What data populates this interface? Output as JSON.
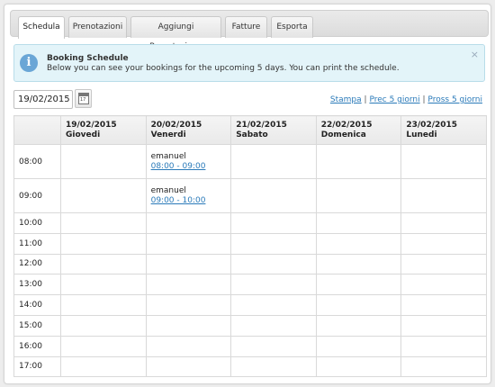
{
  "tabs": [
    "Schedula",
    "Prenotazioni",
    "Aggiungi Prenotazione",
    "Fatture",
    "Esporta"
  ],
  "alert": {
    "title": "Booking Schedule",
    "text": "Below you can see your bookings for the upcoming 5 days. You can print the schedule.",
    "close": "×",
    "icon": "info-icon"
  },
  "date_input": {
    "value": "19/02/2015"
  },
  "calendar_icon_day": "17",
  "links": {
    "print": "Stampa",
    "sep": "|",
    "prev": "Prec 5 giorni",
    "next": "Pross 5 giorni"
  },
  "days": [
    {
      "date": "19/02/2015",
      "name": "Giovedi"
    },
    {
      "date": "20/02/2015",
      "name": "Venerdi"
    },
    {
      "date": "21/02/2015",
      "name": "Sabato"
    },
    {
      "date": "22/02/2015",
      "name": "Domenica"
    },
    {
      "date": "23/02/2015",
      "name": "Lunedi"
    }
  ],
  "hours": [
    "08:00",
    "09:00",
    "10:00",
    "11:00",
    "12:00",
    "13:00",
    "14:00",
    "15:00",
    "16:00",
    "17:00"
  ],
  "bookings": [
    {
      "hour": "08:00",
      "day": 1,
      "name": "emanuel",
      "time": "08:00 - 09:00"
    },
    {
      "hour": "09:00",
      "day": 1,
      "name": "emanuel",
      "time": "09:00 - 10:00"
    }
  ],
  "colors": {
    "link": "#2a7ab9",
    "alert_bg": "#e3f4f9",
    "info_icon": "#6aa6d6"
  }
}
